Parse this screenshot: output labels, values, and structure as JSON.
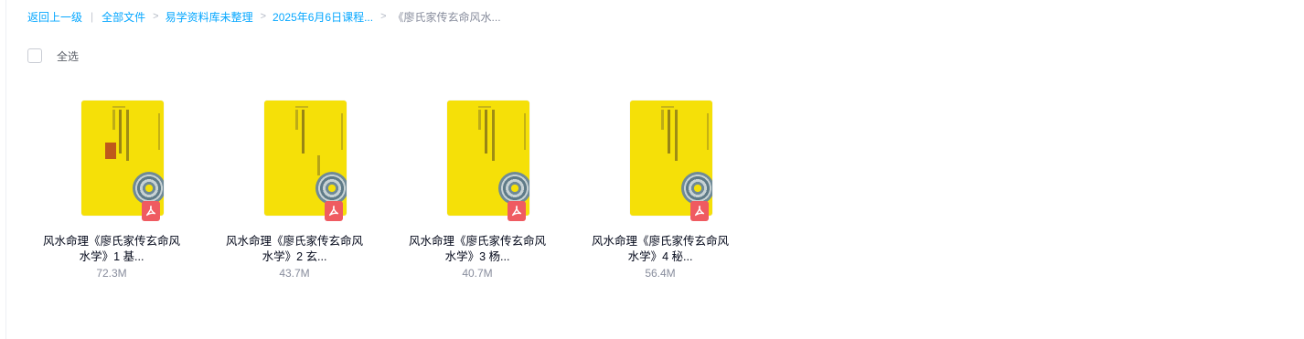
{
  "breadcrumb": {
    "back_label": "返回上一级",
    "items": [
      {
        "label": "全部文件"
      },
      {
        "label": "易学资料库未整理"
      },
      {
        "label": "2025年6月6日课程..."
      }
    ],
    "current": "《廖氏家传玄命风水..."
  },
  "selection": {
    "select_all_label": "全选"
  },
  "files": [
    {
      "name_line1": "风水命理《廖氏家传玄命风",
      "name_line2": "水学》1 基...",
      "size": "72.3M",
      "icon": "pdf-icon"
    },
    {
      "name_line1": "风水命理《廖氏家传玄命风",
      "name_line2": "水学》2 玄...",
      "size": "43.7M",
      "icon": "pdf-icon"
    },
    {
      "name_line1": "风水命理《廖氏家传玄命风",
      "name_line2": "水学》3 杨...",
      "size": "40.7M",
      "icon": "pdf-icon"
    },
    {
      "name_line1": "风水命理《廖氏家传玄命风",
      "name_line2": "水学》4 秘...",
      "size": "56.4M",
      "icon": "pdf-icon"
    }
  ],
  "colors": {
    "link": "#06a7ff",
    "cover": "#f5e008",
    "pdf_badge": "#ef5b61"
  }
}
